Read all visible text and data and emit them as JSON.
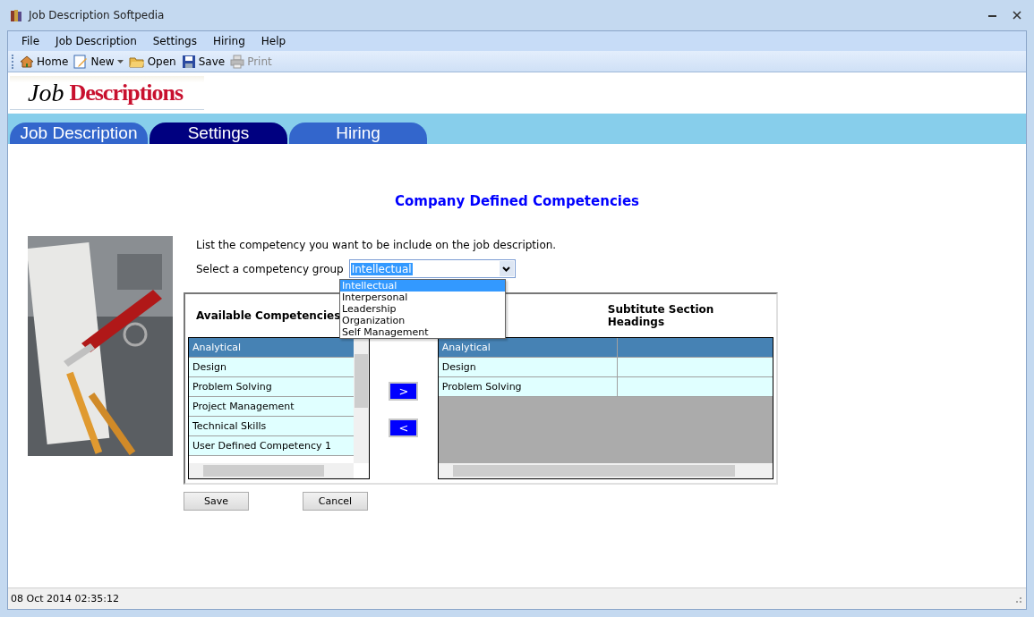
{
  "window": {
    "title": "Job Description Softpedia"
  },
  "menu": [
    "File",
    "Job Description",
    "Settings",
    "Hiring",
    "Help"
  ],
  "toolbar": [
    {
      "label": "Home",
      "kind": "home",
      "disabled": false
    },
    {
      "label": "New",
      "kind": "new",
      "disabled": false
    },
    {
      "label": "Open",
      "kind": "open",
      "disabled": false
    },
    {
      "label": "Save",
      "kind": "save",
      "disabled": false
    },
    {
      "label": "Print",
      "kind": "print",
      "disabled": true
    }
  ],
  "logo": {
    "first": "Job",
    "second": "Descriptions"
  },
  "tabs": [
    {
      "label": "Job Description",
      "selected": false
    },
    {
      "label": "Settings",
      "selected": true
    },
    {
      "label": "Hiring",
      "selected": false
    }
  ],
  "heading": "Company Defined Competencies",
  "instruction": "List the competency you want to be include on the job description.",
  "group_select": {
    "label": "Select a competency group",
    "value": "Intellectual",
    "expanded": true,
    "options": [
      {
        "label": "Intellectual",
        "selected": true
      },
      {
        "label": "Interpersonal",
        "selected": false
      },
      {
        "label": "Leadership",
        "selected": false
      },
      {
        "label": "Organization",
        "selected": false
      },
      {
        "label": "Self Management",
        "selected": false
      }
    ]
  },
  "available": {
    "title": "Available Competencies",
    "items": [
      {
        "label": "Analytical",
        "selected": true
      },
      {
        "label": "Design",
        "selected": false
      },
      {
        "label": "Problem Solving",
        "selected": false
      },
      {
        "label": "Project Management",
        "selected": false
      },
      {
        "label": "Technical Skills",
        "selected": false
      },
      {
        "label": "User Defined Competency 1",
        "selected": false
      }
    ]
  },
  "move_buttons": [
    ">",
    "<"
  ],
  "chosen": {
    "title": "Subtitute Section Headings",
    "rows": [
      {
        "label": "Analytical",
        "selected": true
      },
      {
        "label": "Design",
        "selected": false
      },
      {
        "label": "Problem Solving",
        "selected": false
      }
    ]
  },
  "buttons": [
    "Save",
    "Cancel"
  ],
  "status_bar": "08 Oct 2014 02:35:12"
}
